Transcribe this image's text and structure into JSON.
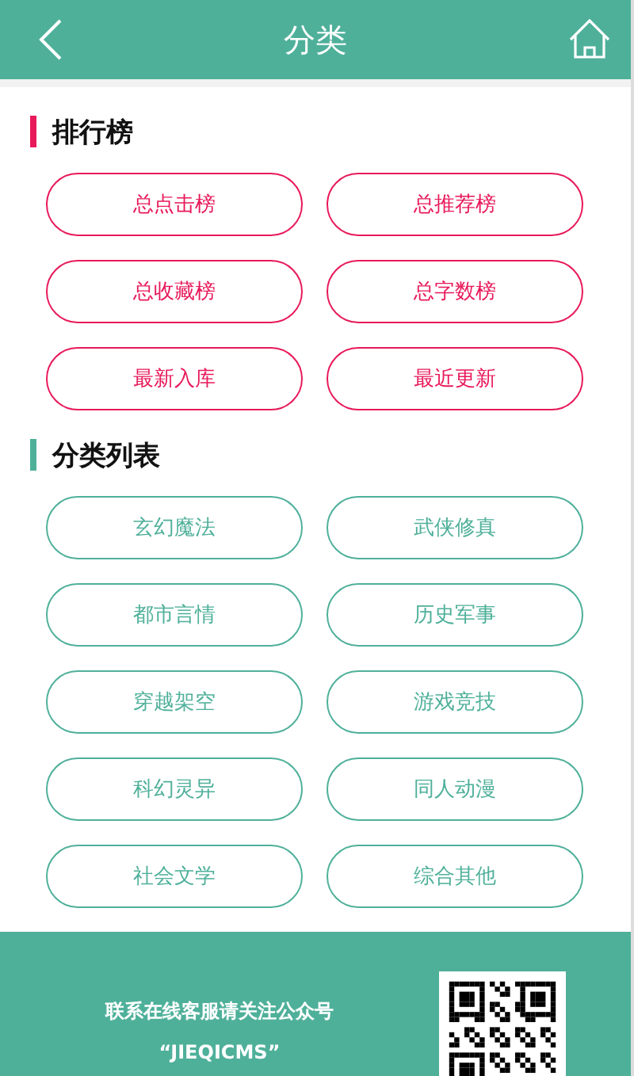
{
  "header": {
    "title": "分类"
  },
  "sections": [
    {
      "title": "排行榜",
      "color": "#e8195a",
      "items": [
        "总点击榜",
        "总推荐榜",
        "总收藏榜",
        "总字数榜",
        "最新入库",
        "最近更新"
      ]
    },
    {
      "title": "分类列表",
      "color": "#4fb09a",
      "items": [
        "玄幻魔法",
        "武侠修真",
        "都市言情",
        "历史军事",
        "穿越架空",
        "游戏竞技",
        "科幻灵异",
        "同人动漫",
        "社会文学",
        "综合其他"
      ]
    }
  ],
  "footer": {
    "lines": [
      "联系在线客服请关注公众号",
      "“JIEQICMS”"
    ]
  }
}
